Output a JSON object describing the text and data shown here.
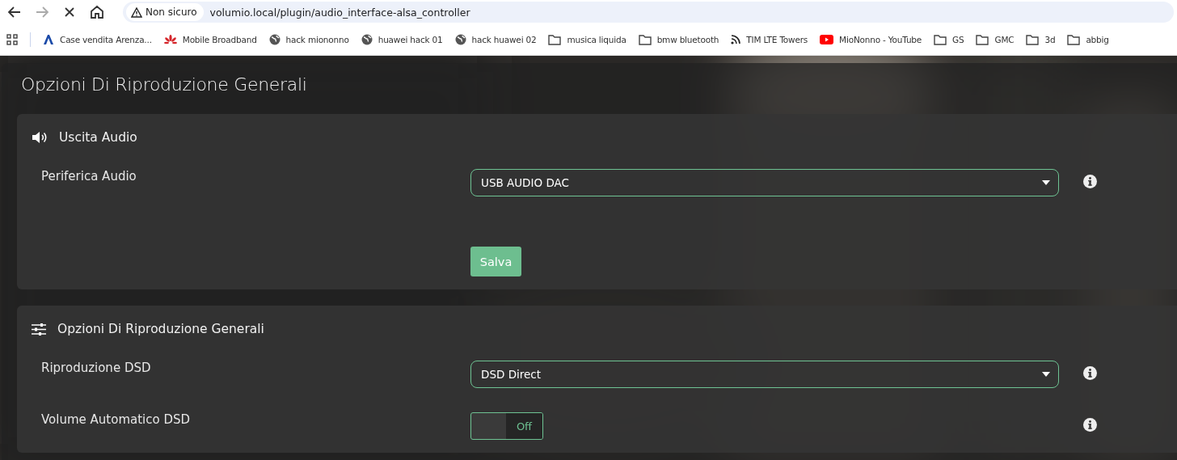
{
  "browser": {
    "security": "Non sicuro",
    "url": "volumio.local/plugin/audio_interface-alsa_controller"
  },
  "bookmarks": [
    {
      "kind": "logo",
      "label": "Case vendita Arenza..."
    },
    {
      "kind": "flower",
      "label": "Mobile Broadband"
    },
    {
      "kind": "globe",
      "label": "hack miononno"
    },
    {
      "kind": "globe",
      "label": "huawei hack 01"
    },
    {
      "kind": "globe",
      "label": "hack huawei 02"
    },
    {
      "kind": "folder",
      "label": "musica liquida"
    },
    {
      "kind": "folder",
      "label": "bmw bluetooth"
    },
    {
      "kind": "feed",
      "label": "TIM LTE Towers"
    },
    {
      "kind": "video",
      "label": "MioNonno - YouTube"
    },
    {
      "kind": "folder",
      "label": "GS"
    },
    {
      "kind": "folder",
      "label": "GMC"
    },
    {
      "kind": "folder",
      "label": "3d"
    },
    {
      "kind": "folder",
      "label": "abbig"
    }
  ],
  "page_title": "Opzioni Di Riproduzione Generali",
  "sections": [
    {
      "kind": "speaker",
      "title": "Uscita Audio",
      "rows": [
        {
          "kind": "select",
          "label": "Periferica Audio",
          "value": "USB AUDIO DAC"
        }
      ],
      "save": "Salva"
    },
    {
      "kind": "sliders",
      "title": "Opzioni Di Riproduzione Generali",
      "rows": [
        {
          "kind": "select",
          "label": "Riproduzione DSD",
          "value": "DSD Direct"
        },
        {
          "kind": "toggle",
          "label": "Volume Automatico DSD",
          "on": false,
          "text": "Off"
        }
      ]
    }
  ]
}
